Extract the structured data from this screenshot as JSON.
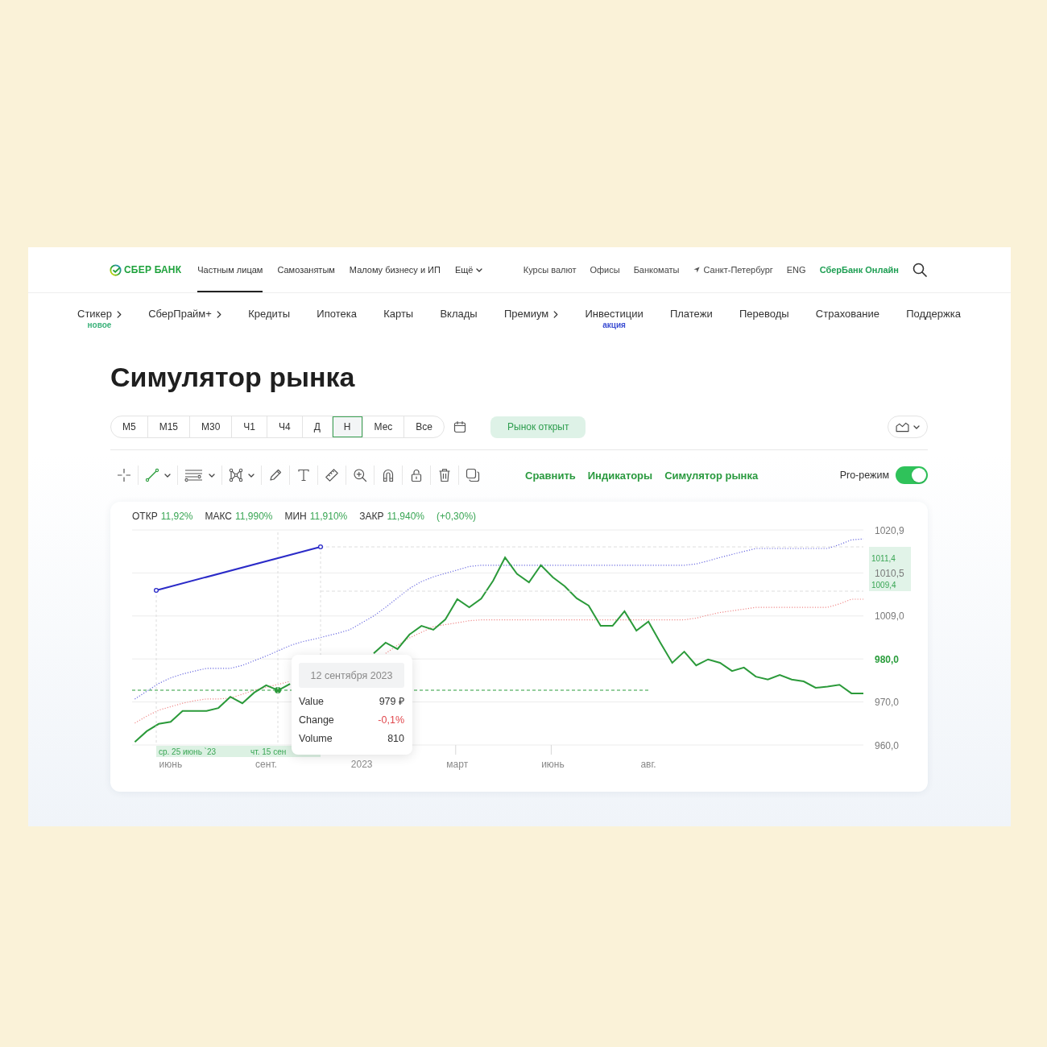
{
  "header": {
    "logo": "СБЕР БАНК",
    "segments": [
      {
        "label": "Частным лицам",
        "selected": true,
        "dropdown": false
      },
      {
        "label": "Самозанятым",
        "selected": false,
        "dropdown": false
      },
      {
        "label": "Малому бизнесу и ИП",
        "selected": false,
        "dropdown": false
      },
      {
        "label": "Ещё",
        "selected": false,
        "dropdown": true
      }
    ],
    "links": [
      {
        "label": "Курсы валют",
        "kind": "plain"
      },
      {
        "label": "Офисы",
        "kind": "plain"
      },
      {
        "label": "Банкоматы",
        "kind": "plain"
      },
      {
        "label": "Санкт-Петербург",
        "kind": "location"
      },
      {
        "label": "ENG",
        "kind": "plain"
      },
      {
        "label": "СберБанк Онлайн",
        "kind": "accent"
      }
    ]
  },
  "main_menu": [
    {
      "label": "Стикер",
      "submenu": true,
      "badge": {
        "text": "новое",
        "color": "#3bb27a"
      }
    },
    {
      "label": "СберПрайм+",
      "submenu": true
    },
    {
      "label": "Кредиты",
      "submenu": false
    },
    {
      "label": "Ипотека",
      "submenu": false
    },
    {
      "label": "Карты",
      "submenu": false
    },
    {
      "label": "Вклады",
      "submenu": false
    },
    {
      "label": "Премиум",
      "submenu": true
    },
    {
      "label": "Инвестиции",
      "submenu": false,
      "badge": {
        "text": "акция",
        "color": "#3d4fd3"
      }
    },
    {
      "label": "Платежи",
      "submenu": false
    },
    {
      "label": "Переводы",
      "submenu": false
    },
    {
      "label": "Страхование",
      "submenu": false
    },
    {
      "label": "Поддержка",
      "submenu": false
    }
  ],
  "page_title": "Симулятор рынка",
  "timeframes": [
    {
      "label": "М5",
      "selected": false
    },
    {
      "label": "М15",
      "selected": false
    },
    {
      "label": "М30",
      "selected": false
    },
    {
      "label": "Ч1",
      "selected": false
    },
    {
      "label": "Ч4",
      "selected": false
    },
    {
      "label": "Д",
      "selected": false
    },
    {
      "label": "Н",
      "selected": true
    },
    {
      "label": "Мес",
      "selected": false
    },
    {
      "label": "Все",
      "selected": false
    }
  ],
  "market_status": "Рынок открыт",
  "tools": [
    {
      "kind": "crosshair",
      "selected": false,
      "dropdown": false
    },
    {
      "kind": "trend-line",
      "selected": true,
      "dropdown": true
    },
    {
      "kind": "parallel-lines",
      "selected": false,
      "dropdown": true
    },
    {
      "kind": "pattern",
      "selected": false,
      "dropdown": true
    },
    {
      "kind": "brush",
      "selected": false,
      "dropdown": false
    },
    {
      "kind": "text",
      "selected": false,
      "dropdown": false
    },
    {
      "kind": "ruler",
      "selected": false,
      "dropdown": false
    },
    {
      "kind": "zoom",
      "selected": false,
      "dropdown": false
    },
    {
      "kind": "magnet",
      "selected": false,
      "dropdown": false
    },
    {
      "kind": "lock",
      "selected": false,
      "dropdown": false
    },
    {
      "kind": "delete",
      "selected": false,
      "dropdown": false
    },
    {
      "kind": "copy",
      "selected": false,
      "dropdown": false
    }
  ],
  "chart_links": [
    "Сравнить",
    "Индикаторы",
    "Симулятор рынка"
  ],
  "pro_mode": {
    "label": "Pro-режим",
    "on": true
  },
  "chart": {
    "stats": [
      {
        "label": "ОТКР",
        "value": "11,92%"
      },
      {
        "label": "МАКС",
        "value": "11,990%"
      },
      {
        "label": "МИН",
        "value": "11,910%"
      },
      {
        "label": "ЗАКР",
        "value": "11,940%"
      }
    ],
    "change": "(+0,30%)",
    "chart_data": {
      "type": "line",
      "categories": [
        null,
        null,
        null,
        "июнь",
        null,
        null,
        null,
        null,
        null,
        null,
        null,
        "сент.",
        null,
        null,
        null,
        null,
        null,
        null,
        null,
        "2023",
        null,
        null,
        null,
        null,
        null,
        null,
        null,
        "март",
        null,
        null,
        null,
        null,
        null,
        null,
        null,
        "июнь",
        null,
        null,
        null,
        null,
        null,
        null,
        null,
        "авг.",
        null,
        null,
        null,
        null,
        null,
        null,
        null,
        null,
        null,
        null,
        null,
        null,
        null,
        null,
        null,
        null,
        null,
        null
      ],
      "series": [
        {
          "color": "#2b9a3a",
          "line_style": "solid",
          "values": [
            960.7,
            963.2,
            964.9,
            965.4,
            967.9,
            967.9,
            967.9,
            968.6,
            971.2,
            969.7,
            972.2,
            973.9,
            972.7,
            974.2,
            null,
            null,
            null,
            null,
            null,
            null,
            981.3,
            983.8,
            982.3,
            985.7,
            987.7,
            986.8,
            989.2,
            993.9,
            992.0,
            994.0,
            998.2,
            1003.6,
            999.8,
            997.8,
            1001.8,
            999.0,
            996.9,
            994.1,
            992.4,
            987.7,
            987.7,
            991.1,
            986.6,
            988.7,
            983.8,
            979.1,
            981.7,
            978.5,
            979.9,
            979.1,
            977.2,
            978.0,
            975.9,
            975.2,
            976.3,
            975.2,
            974.8,
            973.3,
            973.6,
            974.0,
            972.0,
            972.0
          ]
        },
        {
          "color": "#6b6be0",
          "line_style": "dotted",
          "values": [
            970.7,
            972.5,
            974.3,
            975.6,
            976.5,
            977.2,
            977.8,
            977.8,
            977.8,
            978.5,
            979.6,
            980.7,
            981.9,
            983.1,
            984.0,
            984.6,
            985.3,
            986.0,
            986.8,
            988.4,
            990.0,
            992.0,
            994.2,
            996.4,
            998.0,
            999.1,
            999.9,
            1000.7,
            1001.5,
            1001.8,
            1001.8,
            1001.8,
            1001.8,
            1001.8,
            1001.8,
            1001.8,
            1001.8,
            1001.8,
            1001.8,
            1001.8,
            1001.8,
            1001.8,
            1001.8,
            1001.8,
            1001.8,
            1001.8,
            1001.8,
            1002.1,
            1002.8,
            1003.6,
            1004.3,
            1005.0,
            1005.7,
            1005.7,
            1005.7,
            1005.7,
            1005.7,
            1005.7,
            1005.7,
            1006.6,
            1007.7,
            1007.9
          ]
        },
        {
          "color": "#f08a8a",
          "line_style": "dotted",
          "values": [
            965.1,
            966.7,
            968.1,
            968.9,
            969.7,
            970.3,
            970.7,
            970.7,
            970.9,
            971.8,
            972.7,
            973.4,
            974.1,
            974.8,
            null,
            null,
            null,
            null,
            null,
            null,
            null,
            981.3,
            983.2,
            984.9,
            986.2,
            987.5,
            988.0,
            988.4,
            988.9,
            989.1,
            989.1,
            989.1,
            989.1,
            989.1,
            989.1,
            989.1,
            989.1,
            989.1,
            989.1,
            989.1,
            989.1,
            989.1,
            989.1,
            989.1,
            989.1,
            989.1,
            989.1,
            989.5,
            990.2,
            990.8,
            991.2,
            991.6,
            992.0,
            992.0,
            992.0,
            992.0,
            992.0,
            992.0,
            992.0,
            992.8,
            993.9,
            993.9
          ]
        }
      ],
      "ylim": [
        960,
        1010
      ],
      "yticks": [
        {
          "value": 970,
          "label": "970,0"
        },
        {
          "value": 960,
          "label": "960,0"
        }
      ],
      "annotations": [
        "980,0"
      ]
    },
    "scale_labels": [
      "1020,9",
      "1010,5",
      "1009,0"
    ],
    "range": {
      "high": "1011,4",
      "low": "1009,4"
    },
    "date_range": {
      "start": "ср. 25 июнь `23",
      "end": "чт. 15 сен"
    },
    "tooltip": {
      "date": "12 сентября 2023",
      "rows": [
        {
          "label": "Value",
          "value": "979 ₽",
          "kind": "plain"
        },
        {
          "label": "Change",
          "value": "-0,1%",
          "kind": "negative"
        },
        {
          "label": "Volume",
          "value": "810",
          "kind": "plain"
        }
      ]
    }
  }
}
